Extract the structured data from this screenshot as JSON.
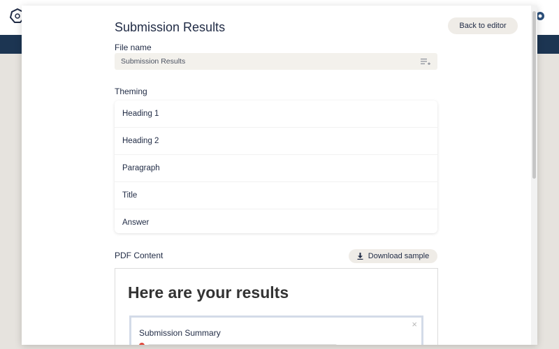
{
  "modal": {
    "title": "Submission Results",
    "back_button_label": "Back to editor"
  },
  "file": {
    "label": "File name",
    "value": "Submission Results"
  },
  "theming": {
    "label": "Theming",
    "items": [
      "Heading 1",
      "Heading 2",
      "Paragraph",
      "Title",
      "Answer"
    ]
  },
  "pdf": {
    "label": "PDF Content",
    "download_label": "Download sample",
    "heading": "Here are your results",
    "summary_title": "Submission Summary",
    "summary_close": "×"
  }
}
